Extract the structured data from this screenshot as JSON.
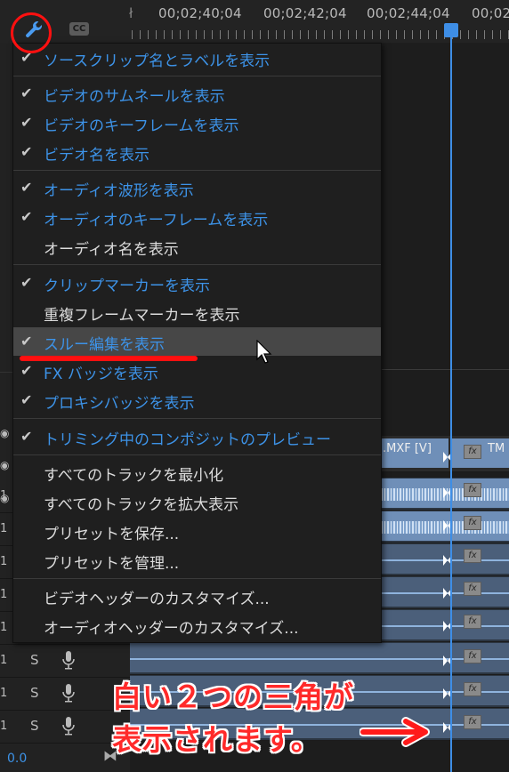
{
  "timeline": {
    "timecodes": [
      "00;02;40;04",
      "00;02;42;04",
      "00;02;44;04",
      "00;02"
    ],
    "cc_label": "CC",
    "clip_label": ".MXF [V]",
    "clip_label2": "TM",
    "fx_label": "fx",
    "bottom_value": "0.0"
  },
  "tracks": [
    {
      "num": "1",
      "s": "",
      "mic": false
    },
    {
      "num": "1",
      "s": "",
      "mic": false
    },
    {
      "num": "1",
      "s": "",
      "mic": false
    },
    {
      "num": "1",
      "s": "",
      "mic": false
    },
    {
      "num": "1",
      "s": "",
      "mic": false
    },
    {
      "num": "1",
      "s": "S",
      "mic": true
    },
    {
      "num": "1",
      "s": "S",
      "mic": true
    },
    {
      "num": "1",
      "s": "S",
      "mic": true
    }
  ],
  "menu": {
    "items": [
      {
        "label": "ソースクリップ名とラベルを表示",
        "checked": true
      },
      {
        "label": "ビデオのサムネールを表示",
        "checked": true
      },
      {
        "label": "ビデオのキーフレームを表示",
        "checked": true
      },
      {
        "label": "ビデオ名を表示",
        "checked": true
      },
      {
        "label": "オーディオ波形を表示",
        "checked": true
      },
      {
        "label": "オーディオのキーフレームを表示",
        "checked": true
      },
      {
        "label": "オーディオ名を表示",
        "checked": false
      },
      {
        "label": "クリップマーカーを表示",
        "checked": true
      },
      {
        "label": "重複フレームマーカーを表示",
        "checked": false
      },
      {
        "label": "スルー編集を表示",
        "checked": true
      },
      {
        "label": "FX バッジを表示",
        "checked": true
      },
      {
        "label": "プロキシバッジを表示",
        "checked": true
      },
      {
        "label": "トリミング中のコンポジットのプレビュー",
        "checked": true
      },
      {
        "label": "すべてのトラックを最小化",
        "checked": false
      },
      {
        "label": "すべてのトラックを拡大表示",
        "checked": false
      },
      {
        "label": "プリセットを保存...",
        "checked": false
      },
      {
        "label": "プリセットを管理...",
        "checked": false
      },
      {
        "label": "ビデオヘッダーのカスタマイズ...",
        "checked": false
      },
      {
        "label": "オーディオヘッダーのカスタマイズ...",
        "checked": false
      }
    ]
  },
  "annotation": {
    "line1": "白い２つの三角が",
    "line2": "表示されます。"
  },
  "colors": {
    "accent": "#3d93e8",
    "annotation": "#ff1010",
    "menu_bg": "#1f1f1f",
    "highlight": "#474747"
  }
}
